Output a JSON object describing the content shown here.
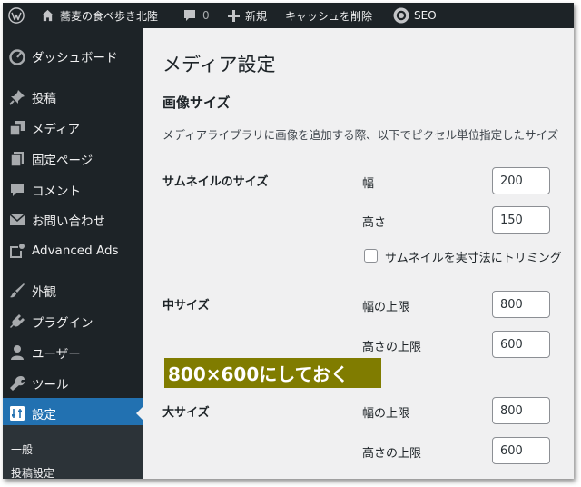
{
  "admin_bar": {
    "site_name": "蕎麦の食べ歩き北陸",
    "comments_count": "0",
    "new_label": "新規",
    "cache_label": "キャッシュを削除",
    "seo_label": "SEO"
  },
  "sidebar": {
    "items": [
      {
        "label": "ダッシュボード",
        "icon": "dashboard-icon"
      },
      {
        "label": "投稿",
        "icon": "pushpin-icon"
      },
      {
        "label": "メディア",
        "icon": "media-icon"
      },
      {
        "label": "固定ページ",
        "icon": "page-icon"
      },
      {
        "label": "コメント",
        "icon": "comment-icon"
      },
      {
        "label": "お問い合わせ",
        "icon": "mail-icon"
      },
      {
        "label": "Advanced Ads",
        "icon": "advanced-ads-icon"
      },
      {
        "label": "外観",
        "icon": "brush-icon"
      },
      {
        "label": "プラグイン",
        "icon": "plugin-icon"
      },
      {
        "label": "ユーザー",
        "icon": "user-icon"
      },
      {
        "label": "ツール",
        "icon": "wrench-icon"
      },
      {
        "label": "設定",
        "icon": "settings-icon",
        "current": true
      }
    ],
    "submenu": [
      "一般",
      "投稿設定"
    ]
  },
  "page": {
    "title": "メディア設定",
    "section_title": "画像サイズ",
    "description": "メディアライブラリに画像を追加する際、以下でピクセル単位指定したサイズ",
    "thumbnail": {
      "label": "サムネイルのサイズ",
      "width_label": "幅",
      "width_value": "200",
      "height_label": "高さ",
      "height_value": "150",
      "crop_label": "サムネイルを実寸法にトリミング"
    },
    "medium": {
      "label": "中サイズ",
      "width_label": "幅の上限",
      "width_value": "800",
      "height_label": "高さの上限",
      "height_value": "600"
    },
    "large": {
      "label": "大サイズ",
      "width_label": "幅の上限",
      "width_value": "800",
      "height_label": "高さの上限",
      "height_value": "600"
    }
  },
  "annotation": {
    "text": "800×600にしておく",
    "bg_color": "#807c00"
  },
  "colors": {
    "admin_dark": "#1d2327",
    "accent_blue": "#2271b1",
    "content_bg": "#f0f0f1"
  }
}
